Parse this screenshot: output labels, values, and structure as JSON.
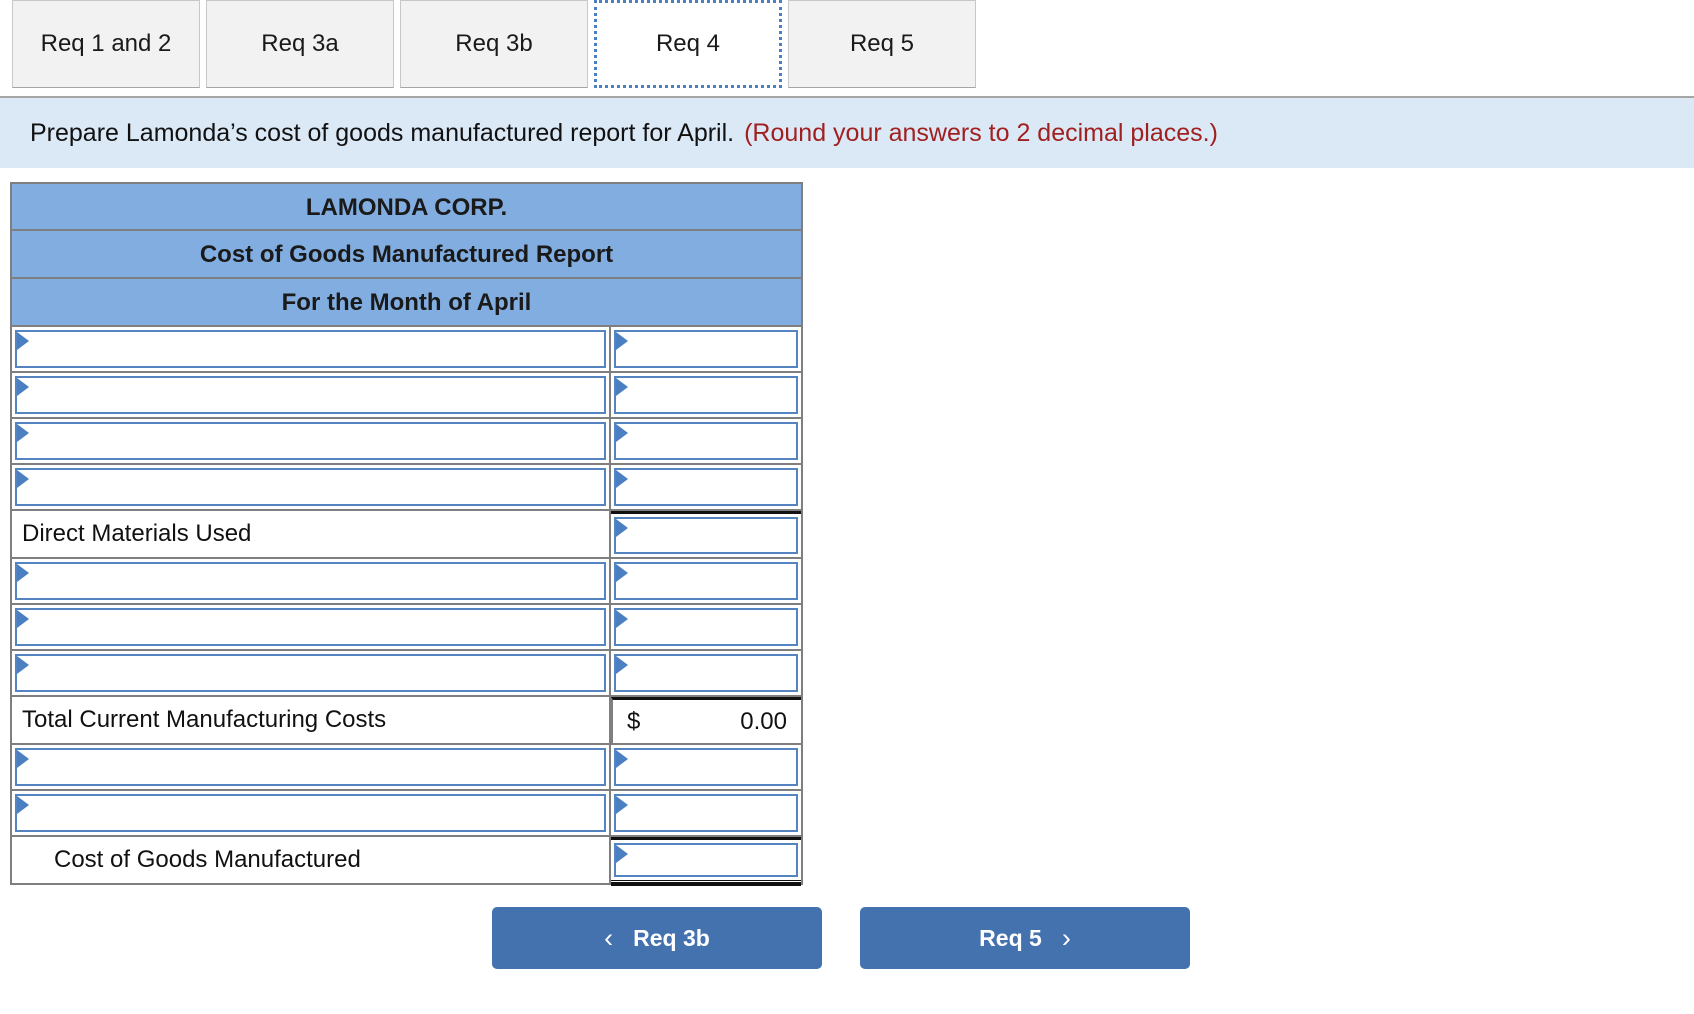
{
  "tabs": [
    {
      "label": "Req 1 and 2",
      "active": false
    },
    {
      "label": "Req 3a",
      "active": false
    },
    {
      "label": "Req 3b",
      "active": false
    },
    {
      "label": "Req 4",
      "active": true
    },
    {
      "label": "Req 5",
      "active": false
    }
  ],
  "banner": {
    "instruction": "Prepare Lamonda’s cost of goods manufactured report for April.",
    "hint": "(Round your answers to 2 decimal places.)"
  },
  "report": {
    "title_line1": "LAMONDA CORP.",
    "title_line2": "Cost of Goods Manufactured Report",
    "title_line3": "For the Month of April",
    "rows": [
      {
        "type": "dropdown",
        "label": "",
        "value": ""
      },
      {
        "type": "dropdown",
        "label": "",
        "value": ""
      },
      {
        "type": "dropdown",
        "label": "",
        "value": ""
      },
      {
        "type": "dropdown",
        "label": "",
        "value": ""
      },
      {
        "type": "static",
        "label": "Direct Materials Used",
        "value": ""
      },
      {
        "type": "dropdown",
        "label": "",
        "value": ""
      },
      {
        "type": "dropdown",
        "label": "",
        "value": ""
      },
      {
        "type": "dropdown",
        "label": "",
        "value": ""
      },
      {
        "type": "total",
        "label": "Total Current Manufacturing Costs",
        "currency": "$",
        "value": "0.00"
      },
      {
        "type": "dropdown",
        "label": "",
        "value": ""
      },
      {
        "type": "dropdown",
        "label": "",
        "value": ""
      },
      {
        "type": "static_indent",
        "label": "Cost of Goods Manufactured",
        "value": ""
      }
    ]
  },
  "nav": {
    "prev_label": "Req 3b",
    "prev_icon": "chevron-left-icon",
    "next_label": "Req 5",
    "next_icon": "chevron-right-icon"
  },
  "colors": {
    "tab_active_border": "#4a7fc1",
    "banner_bg": "#dbe9f7",
    "banner_hint": "#a02020",
    "header_blue": "#82ade0",
    "input_border": "#5585c0",
    "button_blue": "#4472ae",
    "table_border": "#7f7f7f"
  }
}
